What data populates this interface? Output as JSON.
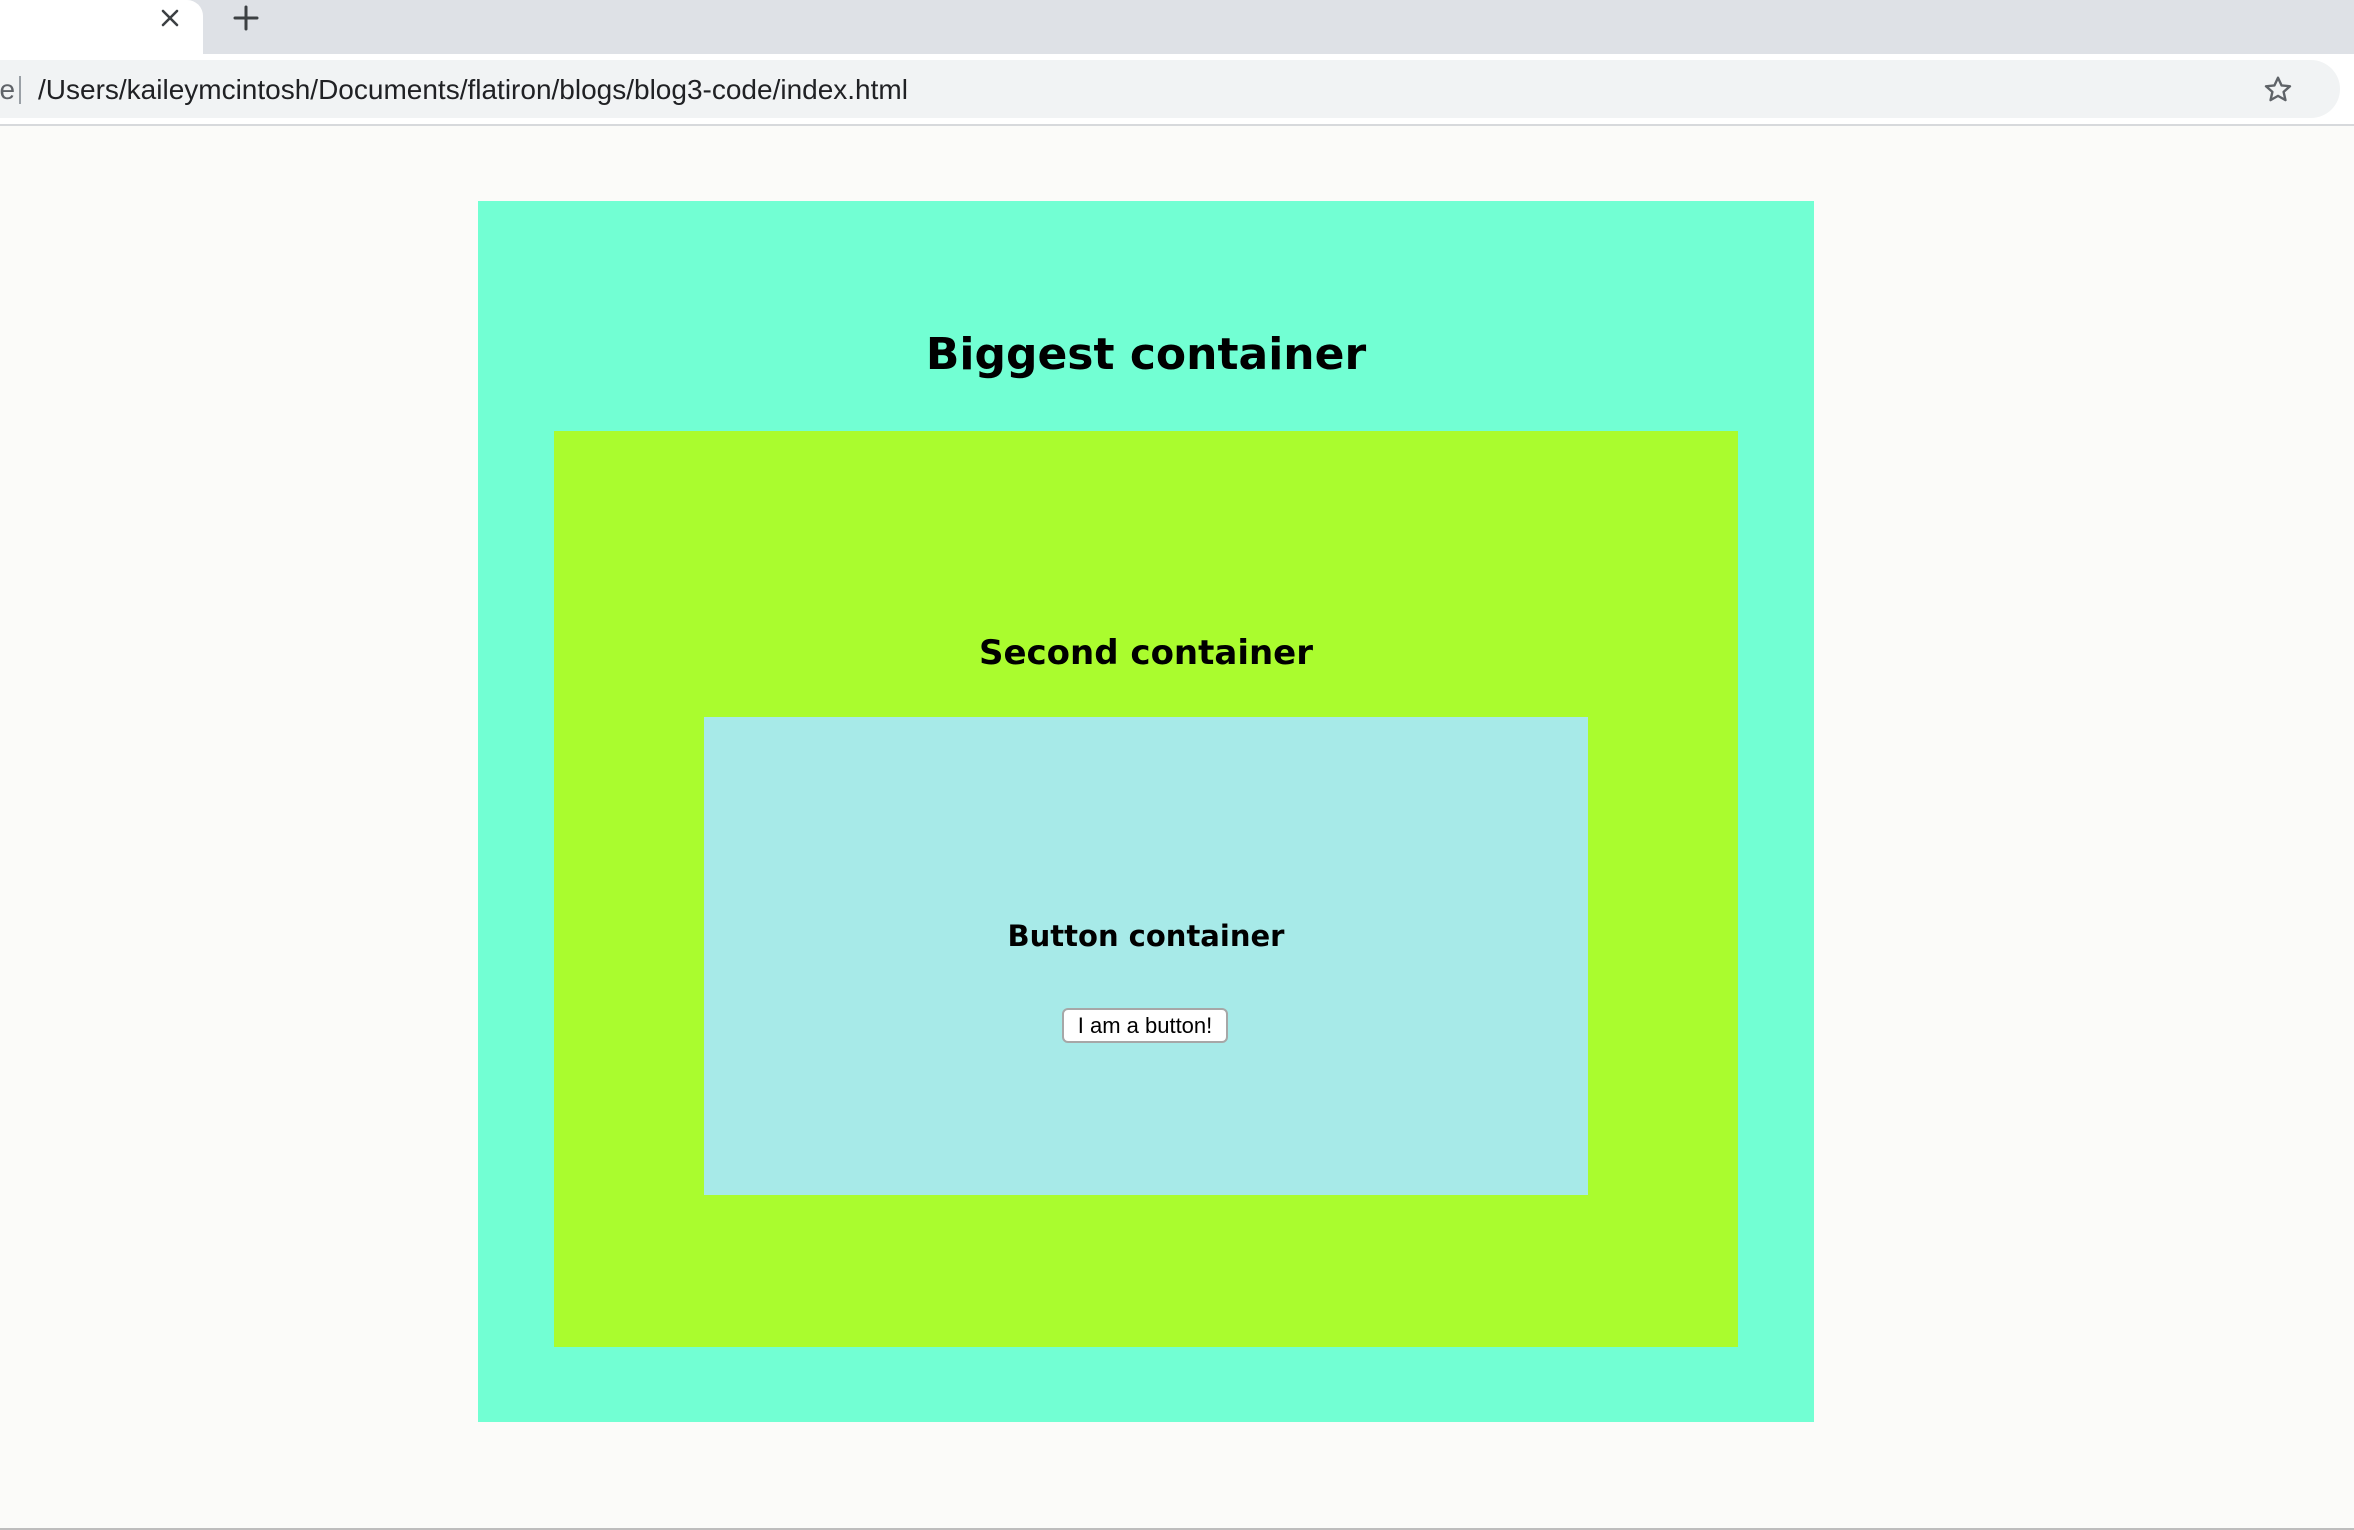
{
  "browser": {
    "tab": {
      "close_glyph": "✕",
      "close_icon": "close-icon"
    },
    "new_tab": {
      "glyph": "+",
      "icon": "plus-icon"
    },
    "address_bar": {
      "scheme_label": "File",
      "url": "/Users/kaileymcintosh/Documents/flatiron/blogs/blog3-code/index.html",
      "bookmark_icon": "star-icon"
    }
  },
  "page": {
    "biggest_container": {
      "heading": "Biggest container",
      "color": "#72ffd3"
    },
    "second_container": {
      "heading": "Second container",
      "color": "#aafc2e"
    },
    "button_container": {
      "heading": "Button container",
      "color": "#a7eae8",
      "button_label": "I am a button!"
    },
    "background_color": "#fbfbf9"
  }
}
